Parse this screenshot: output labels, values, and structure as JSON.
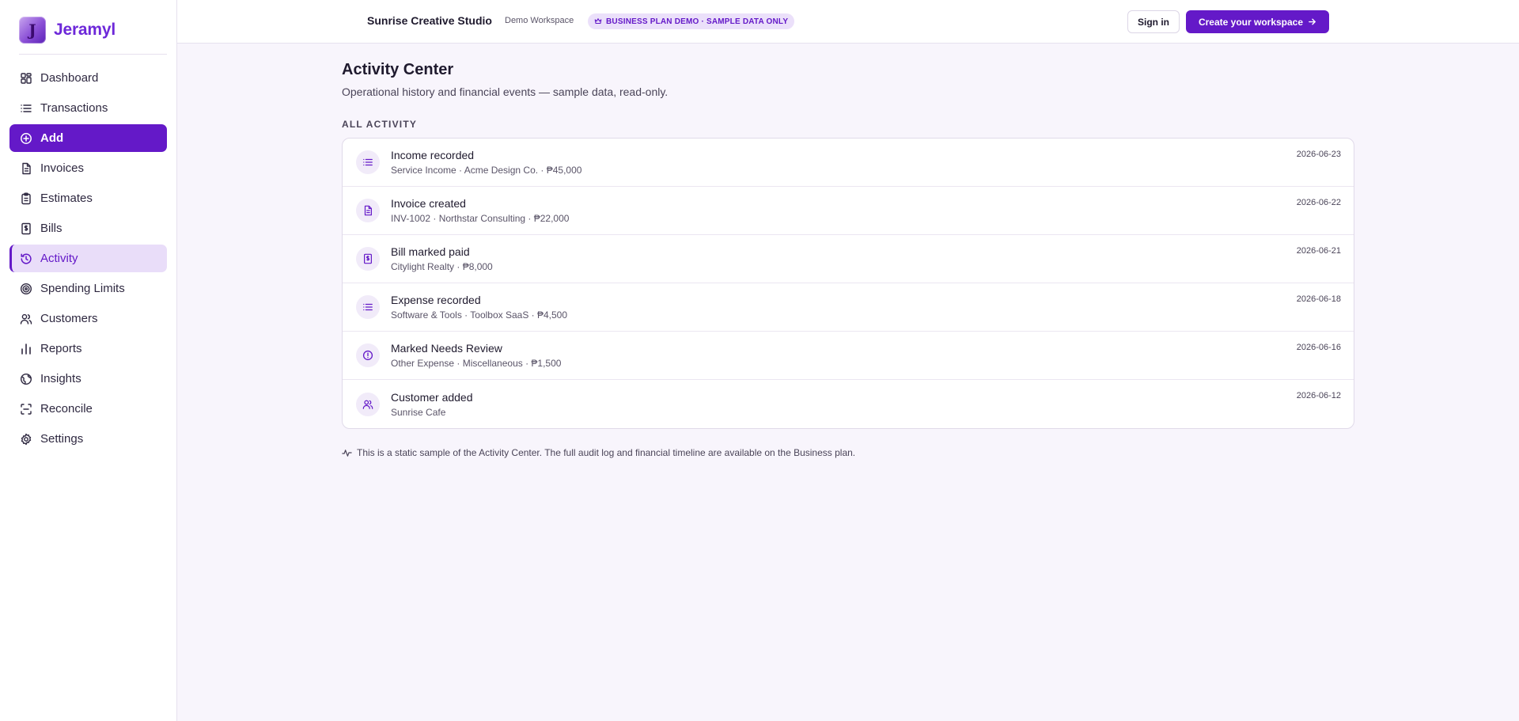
{
  "brand": {
    "logo_letter": "J",
    "name": "Jeramyl"
  },
  "sidebar": {
    "items": [
      {
        "label": "Dashboard",
        "icon": "dashboard-icon"
      },
      {
        "label": "Transactions",
        "icon": "list-icon"
      },
      {
        "label": "Add",
        "icon": "plus-circle-icon"
      },
      {
        "label": "Invoices",
        "icon": "document-icon"
      },
      {
        "label": "Estimates",
        "icon": "clipboard-icon"
      },
      {
        "label": "Bills",
        "icon": "receipt-icon"
      },
      {
        "label": "Activity",
        "icon": "history-icon"
      },
      {
        "label": "Spending Limits",
        "icon": "target-icon"
      },
      {
        "label": "Customers",
        "icon": "users-icon"
      },
      {
        "label": "Reports",
        "icon": "bar-chart-icon"
      },
      {
        "label": "Insights",
        "icon": "globe-icon"
      },
      {
        "label": "Reconcile",
        "icon": "scan-icon"
      },
      {
        "label": "Settings",
        "icon": "gear-icon"
      }
    ],
    "active_item": "Activity"
  },
  "header": {
    "workspace_name": "Sunrise Creative Studio",
    "workspace_type": "Demo Workspace",
    "plan_badge": "BUSINESS PLAN DEMO · SAMPLE DATA ONLY",
    "sign_in_label": "Sign in",
    "create_label": "Create your workspace"
  },
  "main": {
    "title": "Activity Center",
    "subtitle": "Operational history and financial events — sample data, read-only.",
    "section_label": "ALL ACTIVITY",
    "activities": [
      {
        "title": "Income recorded",
        "detail": "Service Income · Acme Design Co. · ₱45,000",
        "date": "2026-06-23",
        "icon": "list-icon"
      },
      {
        "title": "Invoice created",
        "detail": "INV-1002 · Northstar Consulting · ₱22,000",
        "date": "2026-06-22",
        "icon": "document-icon"
      },
      {
        "title": "Bill marked paid",
        "detail": "Citylight Realty · ₱8,000",
        "date": "2026-06-21",
        "icon": "receipt-icon"
      },
      {
        "title": "Expense recorded",
        "detail": "Software & Tools · Toolbox SaaS · ₱4,500",
        "date": "2026-06-18",
        "icon": "list-icon"
      },
      {
        "title": "Marked Needs Review",
        "detail": "Other Expense · Miscellaneous · ₱1,500",
        "date": "2026-06-16",
        "icon": "alert-circle-icon"
      },
      {
        "title": "Customer added",
        "detail": "Sunrise Cafe",
        "date": "2026-06-12",
        "icon": "users-icon"
      }
    ],
    "footnote": "This is a static sample of the Activity Center. The full audit log and financial timeline are available on the Business plan."
  },
  "colors": {
    "accent": "#6419c8",
    "accent_light": "#e9ddf9",
    "background": "#f8f5fc"
  }
}
